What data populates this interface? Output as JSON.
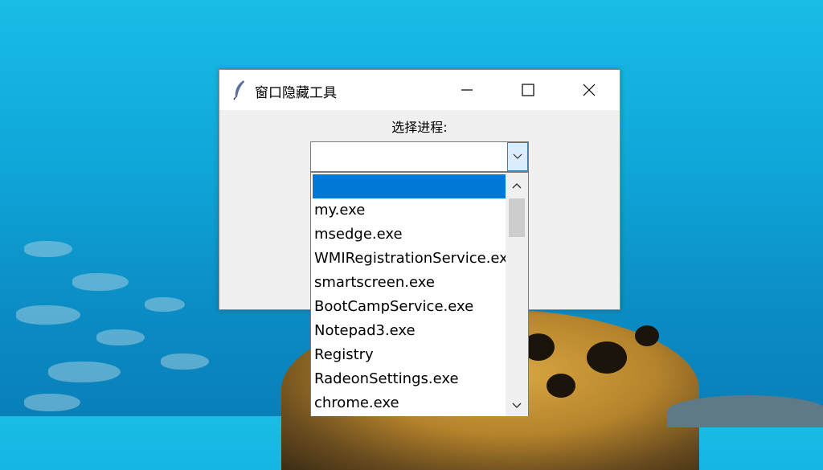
{
  "window": {
    "title": "窗口隐藏工具",
    "icon": "feather-icon"
  },
  "form": {
    "process_label": "选择进程:",
    "combo_value": ""
  },
  "dropdown": {
    "items": [
      "",
      "my.exe",
      "msedge.exe",
      "WMIRegistrationService.exe",
      "smartscreen.exe",
      "BootCampService.exe",
      "Notepad3.exe",
      "Registry",
      "RadeonSettings.exe",
      "chrome.exe"
    ],
    "selected_index": 0
  },
  "colors": {
    "selection": "#0078d7",
    "window_bg": "#f0f0f0"
  }
}
